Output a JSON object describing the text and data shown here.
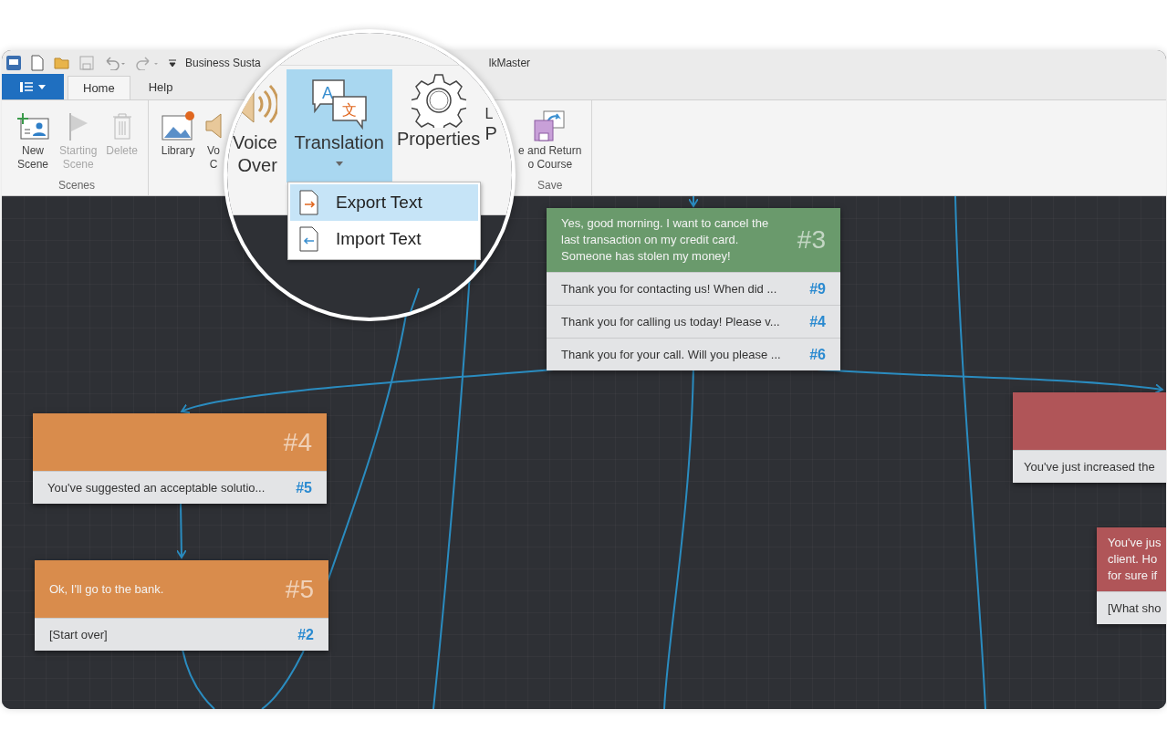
{
  "window": {
    "title_start": "Business Susta",
    "title_end": "lkMaster"
  },
  "tabs": [
    {
      "label": "Home",
      "selected": true
    },
    {
      "label": "Help",
      "selected": false
    }
  ],
  "ribbon": {
    "groups": [
      {
        "label": "Scenes",
        "buttons": [
          {
            "kind": "new-scene",
            "lines": [
              "New",
              "Scene"
            ],
            "disabled": false
          },
          {
            "kind": "flag",
            "lines": [
              "Starting",
              "Scene"
            ],
            "disabled": true
          },
          {
            "kind": "trash",
            "lines": [
              "Delete"
            ],
            "disabled": true
          }
        ]
      },
      {
        "buttons": [
          {
            "kind": "library",
            "lines": [
              "Library"
            ],
            "disabled": false
          },
          {
            "kind": "speaker",
            "lines": [
              "Vo",
              "C"
            ],
            "disabled": false
          }
        ]
      },
      {
        "label": "Save",
        "buttons": [
          {
            "kind": "save-return",
            "lines": [
              "e and Return",
              "o Course"
            ],
            "disabled": false
          }
        ]
      }
    ]
  },
  "magnifier": {
    "buttons": [
      {
        "kind": "voice",
        "lines": [
          "Voice",
          "Over"
        ],
        "selected": false
      },
      {
        "kind": "translation",
        "lines": [
          "Translation"
        ],
        "selected": true,
        "dropdown": true,
        "glyphs": [
          "A",
          "文"
        ]
      },
      {
        "kind": "properties",
        "lines": [
          "Properties"
        ],
        "selected": false
      },
      {
        "kind": "partial",
        "top": "L",
        "lines": [
          "P"
        ],
        "selected": false
      }
    ],
    "menu": [
      {
        "kind": "export",
        "label": "Export Text",
        "selected": true
      },
      {
        "kind": "import",
        "label": "Import Text",
        "selected": false
      }
    ]
  },
  "nodes": [
    {
      "number": "#3",
      "color": "#6a9a6c",
      "lines": [
        "Yes, good morning. I want to cancel the",
        "last transaction on my credit card.",
        "Someone has stolen my money!"
      ],
      "replies": [
        {
          "text": "Thank you for contacting us! When did ...",
          "target": "#9"
        },
        {
          "text": "Thank you for calling us today! Please v...",
          "target": "#4"
        },
        {
          "text": "Thank you for your call. Will you please ...",
          "target": "#6"
        }
      ]
    },
    {
      "number": "#4",
      "color": "#d98c4c",
      "replies": [
        {
          "text": "You've suggested an acceptable solutio...",
          "target": "#5"
        }
      ]
    },
    {
      "number": "#5",
      "color": "#d98c4c",
      "lines": [
        "Ok, I'll go to the bank."
      ],
      "replies": [
        {
          "text": "[Start over]",
          "target": "#2"
        }
      ]
    },
    {
      "color": "#b05558",
      "replies": [
        {
          "text": "You've just increased the"
        }
      ]
    },
    {
      "color": "#b05558",
      "lines": [
        "You've jus",
        "client. Ho",
        "for sure if"
      ],
      "replies": [
        {
          "text": "[What sho"
        }
      ]
    }
  ]
}
